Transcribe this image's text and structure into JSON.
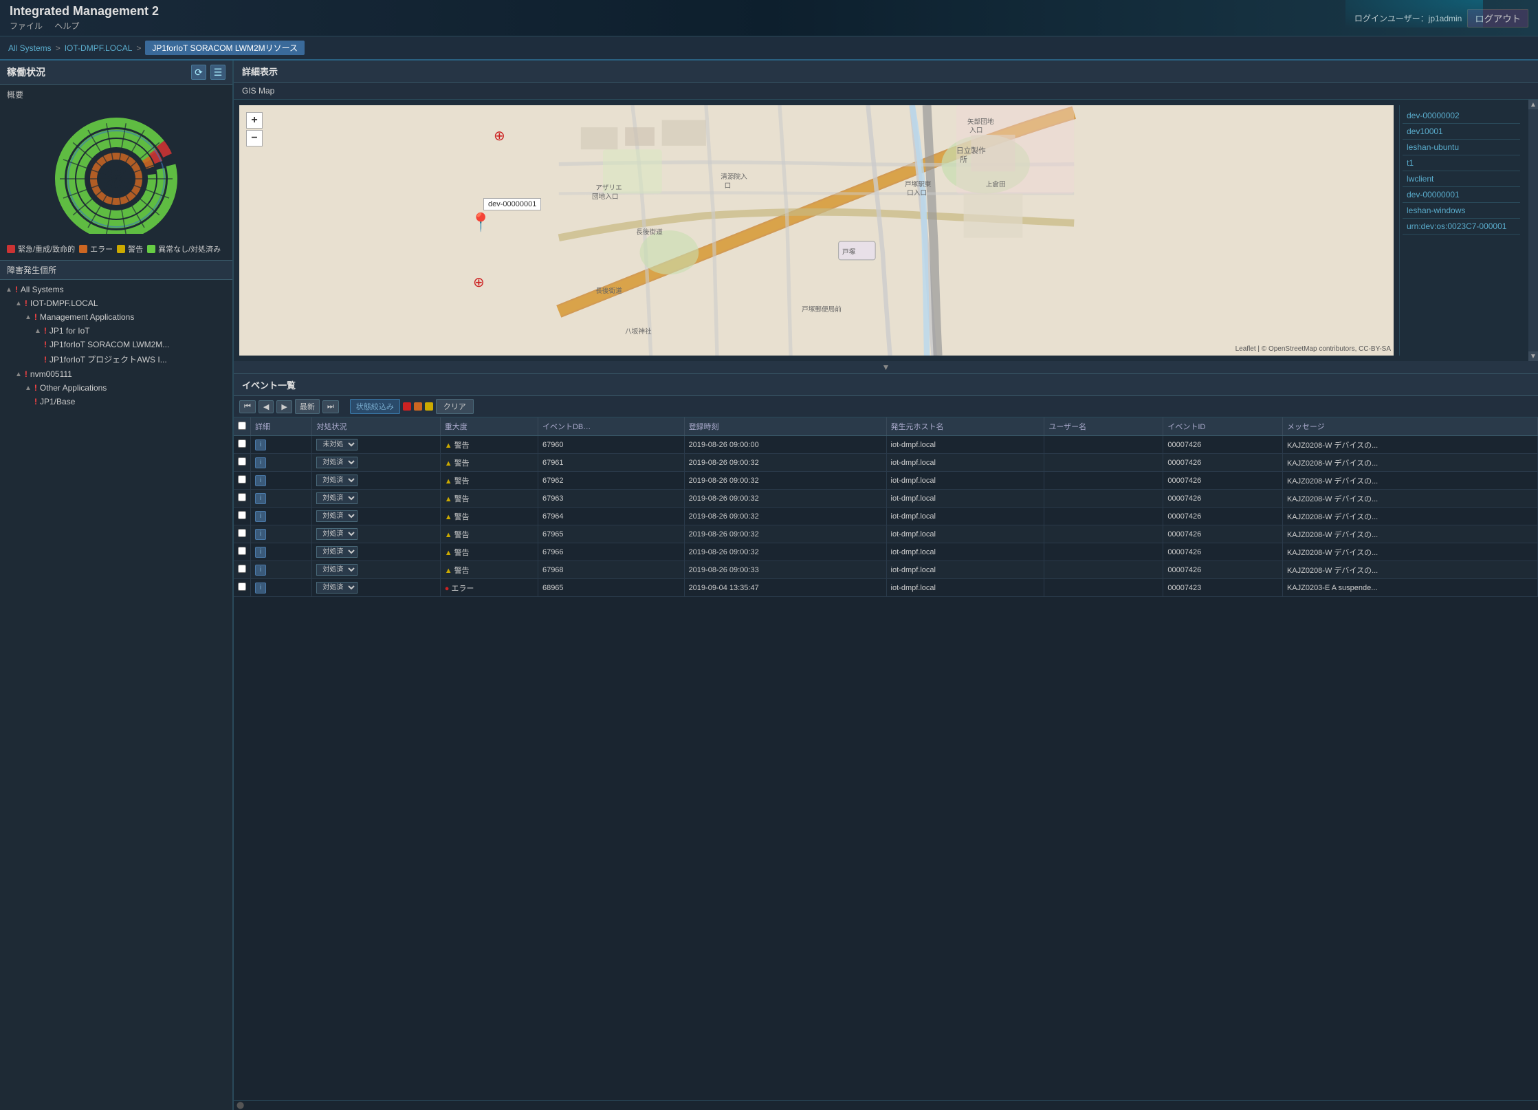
{
  "app": {
    "title": "Integrated Management 2",
    "menu": {
      "file": "ファイル",
      "help": "ヘルプ"
    },
    "user_label": "ログインユーザー：jp1admin",
    "logout_label": "ログアウト"
  },
  "breadcrumb": {
    "all_systems": "All Systems",
    "sep1": ">",
    "iot_dmpf": "IOT-DMPF.LOCAL",
    "sep2": ">",
    "current": "JP1forIoT SORACOM LWM2Mリソース"
  },
  "left_panel": {
    "title": "稼働状況",
    "overview_label": "概要",
    "legend": [
      {
        "color": "#cc3333",
        "label": "緊急/重成/致命的"
      },
      {
        "color": "#cc6622",
        "label": "エラー"
      },
      {
        "color": "#ccaa00",
        "label": "警告"
      },
      {
        "color": "#66cc44",
        "label": "異常なし/対処済み"
      }
    ],
    "fault_title": "障害発生個所",
    "tree": [
      {
        "indent": 0,
        "arrow": "▲",
        "alert": true,
        "label": "All Systems"
      },
      {
        "indent": 1,
        "arrow": "▲",
        "alert": true,
        "label": "IOT-DMPF.LOCAL"
      },
      {
        "indent": 2,
        "arrow": "▲",
        "alert": true,
        "label": "Management Applications"
      },
      {
        "indent": 3,
        "arrow": "▲",
        "alert": true,
        "label": "JP1 for IoT"
      },
      {
        "indent": 4,
        "arrow": "",
        "alert": true,
        "label": "JP1forIoT SORACOM LWM2M..."
      },
      {
        "indent": 4,
        "arrow": "",
        "alert": true,
        "label": "JP1forIoT プロジェクトAWS I..."
      },
      {
        "indent": 1,
        "arrow": "▲",
        "alert": true,
        "label": "nvm005111"
      },
      {
        "indent": 2,
        "arrow": "▲",
        "alert": true,
        "label": "Other Applications"
      },
      {
        "indent": 3,
        "arrow": "",
        "alert": true,
        "label": "JP1/Base"
      }
    ]
  },
  "right_panel": {
    "detail_title": "詳細表示",
    "gis_label": "GIS Map",
    "map_zoom_in": "+",
    "map_zoom_out": "−",
    "map_marker_label": "dev-00000001",
    "map_attribution": "Leaflet | © OpenStreetMap contributors, CC-BY-SA",
    "devices": [
      "dev-00000002",
      "dev10001",
      "leshan-ubuntu",
      "t1",
      "lwclient",
      "dev-00000001",
      "leshan-windows",
      "urn:dev:os:0023C7-000001"
    ],
    "event_title": "イベント一覧",
    "toolbar": {
      "first": "⏮",
      "prev": "◀",
      "next_page": "▶",
      "latest": "最新",
      "fast_forward": "⏭",
      "filter": "状態絞込み",
      "clear": "クリア"
    },
    "event_columns": [
      "",
      "詳細",
      "対処状況",
      "重大度",
      "イベントDB…",
      "登録時刻",
      "発生元ホスト名",
      "ユーザー名",
      "イベントID",
      "メッセージ"
    ],
    "events": [
      {
        "checked": false,
        "detail": "i",
        "status": "未対処",
        "severity_type": "warning",
        "severity_icon": "⚠",
        "severity_text": "警告",
        "event_db": "67960",
        "time": "2019-08-26 09:00:00",
        "host": "iot-dmpf.local",
        "user": "",
        "event_id": "00007426",
        "message": "KAJZ0208-W デバイスの..."
      },
      {
        "checked": false,
        "detail": "i",
        "status": "対処済",
        "severity_type": "warning",
        "severity_icon": "⚠",
        "severity_text": "警告",
        "event_db": "67961",
        "time": "2019-08-26 09:00:32",
        "host": "iot-dmpf.local",
        "user": "",
        "event_id": "00007426",
        "message": "KAJZ0208-W デバイスの..."
      },
      {
        "checked": false,
        "detail": "i",
        "status": "対処済",
        "severity_type": "warning",
        "severity_icon": "⚠",
        "severity_text": "警告",
        "event_db": "67962",
        "time": "2019-08-26 09:00:32",
        "host": "iot-dmpf.local",
        "user": "",
        "event_id": "00007426",
        "message": "KAJZ0208-W デバイスの..."
      },
      {
        "checked": false,
        "detail": "i",
        "status": "対処済",
        "severity_type": "warning",
        "severity_icon": "⚠",
        "severity_text": "警告",
        "event_db": "67963",
        "time": "2019-08-26 09:00:32",
        "host": "iot-dmpf.local",
        "user": "",
        "event_id": "00007426",
        "message": "KAJZ0208-W デバイスの..."
      },
      {
        "checked": false,
        "detail": "i",
        "status": "対処済",
        "severity_type": "warning",
        "severity_icon": "⚠",
        "severity_text": "警告",
        "event_db": "67964",
        "time": "2019-08-26 09:00:32",
        "host": "iot-dmpf.local",
        "user": "",
        "event_id": "00007426",
        "message": "KAJZ0208-W デバイスの..."
      },
      {
        "checked": false,
        "detail": "i",
        "status": "対処済",
        "severity_type": "warning",
        "severity_icon": "⚠",
        "severity_text": "警告",
        "event_db": "67965",
        "time": "2019-08-26 09:00:32",
        "host": "iot-dmpf.local",
        "user": "",
        "event_id": "00007426",
        "message": "KAJZ0208-W デバイスの..."
      },
      {
        "checked": false,
        "detail": "i",
        "status": "対処済",
        "severity_type": "warning",
        "severity_icon": "⚠",
        "severity_text": "警告",
        "event_db": "67966",
        "time": "2019-08-26 09:00:32",
        "host": "iot-dmpf.local",
        "user": "",
        "event_id": "00007426",
        "message": "KAJZ0208-W デバイスの..."
      },
      {
        "checked": false,
        "detail": "i",
        "status": "対処済",
        "severity_type": "warning",
        "severity_icon": "⚠",
        "severity_text": "警告",
        "event_db": "67968",
        "time": "2019-08-26 09:00:33",
        "host": "iot-dmpf.local",
        "user": "",
        "event_id": "00007426",
        "message": "KAJZ0208-W デバイスの..."
      },
      {
        "checked": false,
        "detail": "i",
        "status": "対処済",
        "severity_type": "error",
        "severity_icon": "●",
        "severity_text": "エラー",
        "event_db": "68965",
        "time": "2019-09-04 13:35:47",
        "host": "iot-dmpf.local",
        "user": "",
        "event_id": "00007423",
        "message": "KAJZ0203-E A suspende..."
      }
    ]
  }
}
